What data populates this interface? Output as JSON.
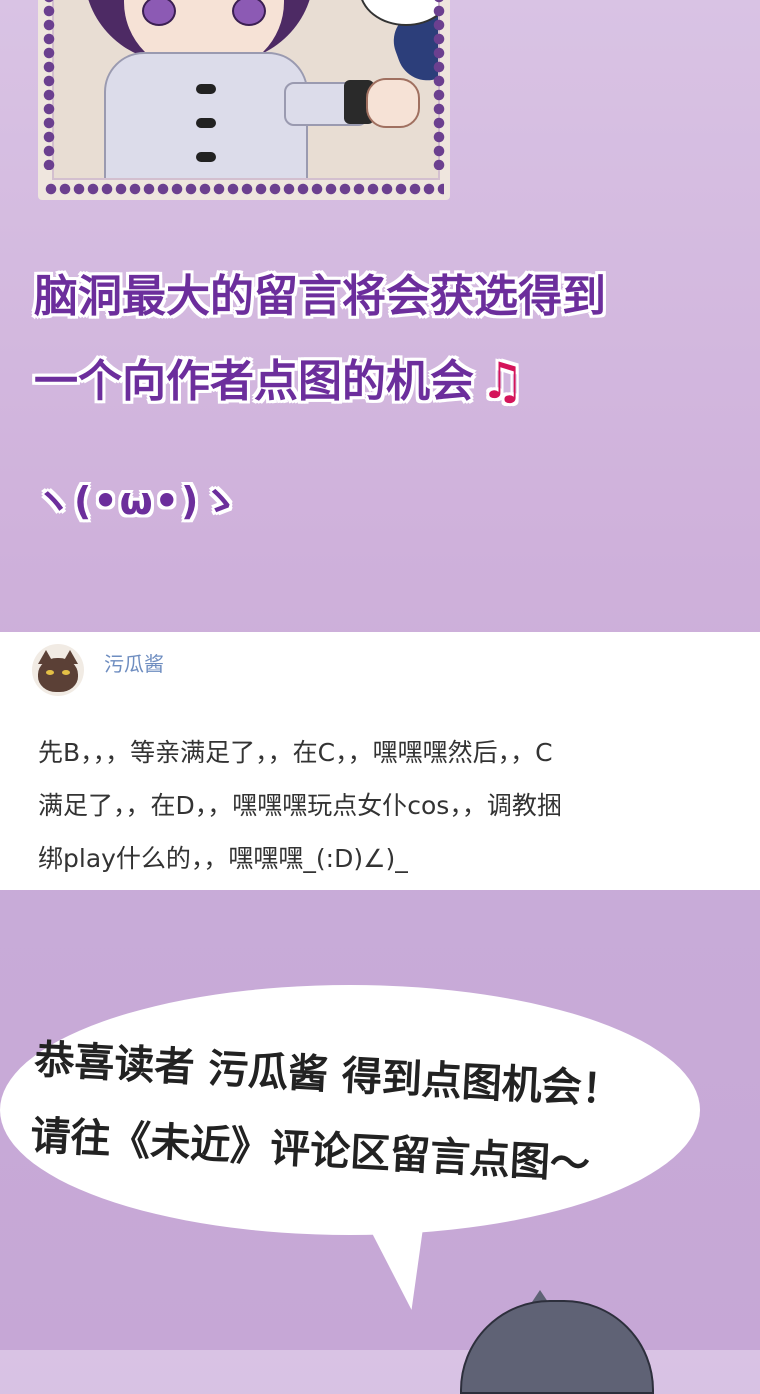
{
  "headline": {
    "line1": "脑洞最大的留言将会获选得到",
    "line2": "一个向作者点图的机会",
    "music_icon": "♫",
    "kaomoji": "ヽ(•ω•)ゝ"
  },
  "comment": {
    "username": "污瓜酱",
    "avatar_icon": "cat-avatar-icon",
    "text_lines": [
      "先B，，，等亲满足了，，在C，，嘿嘿嘿然后，，C",
      "满足了，，在D，，嘿嘿嘿玩点女仆cos，，调教捆",
      "绑play什么的，，嘿嘿嘿_(:D)∠)_"
    ]
  },
  "bubble": {
    "line1": "恭喜读者 污瓜酱 得到点图机会！",
    "line2": "请往《未近》评论区留言点图～"
  },
  "colors": {
    "headline": "#6c2e9c",
    "music": "#d4145a",
    "username": "#6e8dc0",
    "background": "#d9c3e4"
  }
}
